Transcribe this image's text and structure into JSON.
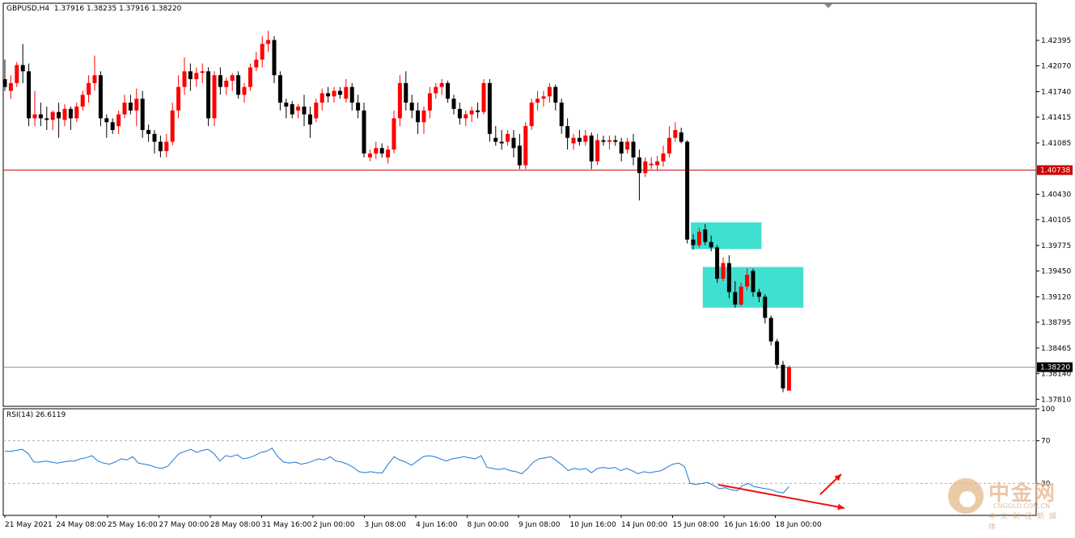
{
  "header": {
    "symbol": "GBPUSD,H4",
    "open": "1.37916",
    "high": "1.38235",
    "low": "1.37916",
    "close": "1.38220"
  },
  "rsi_label": "RSI(14) 26.6119",
  "watermark": {
    "cn": "中金网",
    "en": "CNGOLD.COM.CN",
    "sub": "中文财经新媒体"
  },
  "colors": {
    "bull": "#ff0000",
    "bear": "#000000",
    "hline": "#cc0000",
    "zone": "#40e0d0",
    "rsi": "#1e78d0",
    "arrow": "#ee1111"
  },
  "chart_data": [
    {
      "type": "candlestick",
      "title": "GBPUSD,H4",
      "ylim": [
        1.3772,
        1.4287
      ],
      "yticks": [
        "1.42395",
        "1.42070",
        "1.41740",
        "1.41415",
        "1.41085",
        "1.40430",
        "1.40105",
        "1.39775",
        "1.39450",
        "1.39120",
        "1.38795",
        "1.38465",
        "1.38140",
        "1.37810"
      ],
      "xticks": [
        "21 May 2021",
        "24 May 08:00",
        "25 May 16:00",
        "27 May 00:00",
        "28 May 08:00",
        "31 May 16:00",
        "2 Jun 00:00",
        "3 Jun 08:00",
        "4 Jun 16:00",
        "8 Jun 00:00",
        "9 Jun 08:00",
        "10 Jun 16:00",
        "14 Jun 00:00",
        "15 Jun 08:00",
        "16 Jun 16:00",
        "18 Jun 00:00"
      ],
      "hlines": [
        {
          "value": 1.40738,
          "label": "1.40738",
          "style": "red"
        },
        {
          "value": 1.3822,
          "label": "1.38220",
          "style": "current"
        }
      ],
      "zones": [
        {
          "from_index": 115,
          "to_index": 126,
          "low": 1.3973,
          "high": 1.4007
        },
        {
          "from_index": 117,
          "to_index": 133,
          "low": 1.3898,
          "high": 1.395
        }
      ],
      "candles": [
        {
          "o": 1.419,
          "h": 1.4215,
          "l": 1.4175,
          "c": 1.418
        },
        {
          "o": 1.4175,
          "h": 1.4195,
          "l": 1.4165,
          "c": 1.4185
        },
        {
          "o": 1.4185,
          "h": 1.4212,
          "l": 1.418,
          "c": 1.4208
        },
        {
          "o": 1.4208,
          "h": 1.4235,
          "l": 1.4185,
          "c": 1.42
        },
        {
          "o": 1.42,
          "h": 1.421,
          "l": 1.413,
          "c": 1.414
        },
        {
          "o": 1.414,
          "h": 1.4175,
          "l": 1.413,
          "c": 1.4145
        },
        {
          "o": 1.4145,
          "h": 1.416,
          "l": 1.413,
          "c": 1.414
        },
        {
          "o": 1.414,
          "h": 1.4155,
          "l": 1.4125,
          "c": 1.4138
        },
        {
          "o": 1.4138,
          "h": 1.415,
          "l": 1.4125,
          "c": 1.4148
        },
        {
          "o": 1.4148,
          "h": 1.416,
          "l": 1.4115,
          "c": 1.414
        },
        {
          "o": 1.4138,
          "h": 1.4158,
          "l": 1.413,
          "c": 1.4152
        },
        {
          "o": 1.4152,
          "h": 1.4155,
          "l": 1.4125,
          "c": 1.414
        },
        {
          "o": 1.414,
          "h": 1.416,
          "l": 1.4135,
          "c": 1.4155
        },
        {
          "o": 1.4155,
          "h": 1.4175,
          "l": 1.415,
          "c": 1.417
        },
        {
          "o": 1.417,
          "h": 1.4195,
          "l": 1.416,
          "c": 1.4185
        },
        {
          "o": 1.4185,
          "h": 1.422,
          "l": 1.4175,
          "c": 1.4195
        },
        {
          "o": 1.4195,
          "h": 1.42,
          "l": 1.413,
          "c": 1.414
        },
        {
          "o": 1.414,
          "h": 1.4145,
          "l": 1.4115,
          "c": 1.4135
        },
        {
          "o": 1.4135,
          "h": 1.414,
          "l": 1.412,
          "c": 1.4125
        },
        {
          "o": 1.413,
          "h": 1.415,
          "l": 1.412,
          "c": 1.4145
        },
        {
          "o": 1.4145,
          "h": 1.417,
          "l": 1.414,
          "c": 1.416
        },
        {
          "o": 1.416,
          "h": 1.417,
          "l": 1.4145,
          "c": 1.415
        },
        {
          "o": 1.415,
          "h": 1.4178,
          "l": 1.413,
          "c": 1.4165
        },
        {
          "o": 1.4165,
          "h": 1.4175,
          "l": 1.4115,
          "c": 1.4125
        },
        {
          "o": 1.4125,
          "h": 1.4132,
          "l": 1.411,
          "c": 1.412
        },
        {
          "o": 1.412,
          "h": 1.4125,
          "l": 1.4095,
          "c": 1.411
        },
        {
          "o": 1.411,
          "h": 1.4118,
          "l": 1.409,
          "c": 1.4098
        },
        {
          "o": 1.4098,
          "h": 1.412,
          "l": 1.409,
          "c": 1.411
        },
        {
          "o": 1.411,
          "h": 1.416,
          "l": 1.4105,
          "c": 1.415
        },
        {
          "o": 1.415,
          "h": 1.4195,
          "l": 1.414,
          "c": 1.418
        },
        {
          "o": 1.418,
          "h": 1.4218,
          "l": 1.417,
          "c": 1.42
        },
        {
          "o": 1.42,
          "h": 1.421,
          "l": 1.4175,
          "c": 1.419
        },
        {
          "o": 1.419,
          "h": 1.4205,
          "l": 1.418,
          "c": 1.4198
        },
        {
          "o": 1.4198,
          "h": 1.421,
          "l": 1.4185,
          "c": 1.42
        },
        {
          "o": 1.42,
          "h": 1.4205,
          "l": 1.413,
          "c": 1.414
        },
        {
          "o": 1.414,
          "h": 1.42,
          "l": 1.413,
          "c": 1.4195
        },
        {
          "o": 1.4195,
          "h": 1.4205,
          "l": 1.417,
          "c": 1.418
        },
        {
          "o": 1.418,
          "h": 1.4192,
          "l": 1.417,
          "c": 1.4188
        },
        {
          "o": 1.4188,
          "h": 1.4198,
          "l": 1.4175,
          "c": 1.4195
        },
        {
          "o": 1.4195,
          "h": 1.42,
          "l": 1.4165,
          "c": 1.417
        },
        {
          "o": 1.417,
          "h": 1.4185,
          "l": 1.416,
          "c": 1.418
        },
        {
          "o": 1.418,
          "h": 1.421,
          "l": 1.4175,
          "c": 1.4205
        },
        {
          "o": 1.4205,
          "h": 1.4225,
          "l": 1.42,
          "c": 1.4215
        },
        {
          "o": 1.4215,
          "h": 1.4245,
          "l": 1.4205,
          "c": 1.4235
        },
        {
          "o": 1.4235,
          "h": 1.4252,
          "l": 1.4225,
          "c": 1.424
        },
        {
          "o": 1.424,
          "h": 1.4245,
          "l": 1.4185,
          "c": 1.4195
        },
        {
          "o": 1.4195,
          "h": 1.42,
          "l": 1.415,
          "c": 1.416
        },
        {
          "o": 1.416,
          "h": 1.4165,
          "l": 1.414,
          "c": 1.4155
        },
        {
          "o": 1.4158,
          "h": 1.4162,
          "l": 1.414,
          "c": 1.4145
        },
        {
          "o": 1.415,
          "h": 1.4158,
          "l": 1.414,
          "c": 1.4155
        },
        {
          "o": 1.4155,
          "h": 1.417,
          "l": 1.413,
          "c": 1.4145
        },
        {
          "o": 1.4145,
          "h": 1.4155,
          "l": 1.4115,
          "c": 1.4132
        },
        {
          "o": 1.414,
          "h": 1.4165,
          "l": 1.4135,
          "c": 1.416
        },
        {
          "o": 1.416,
          "h": 1.4178,
          "l": 1.415,
          "c": 1.4172
        },
        {
          "o": 1.4172,
          "h": 1.418,
          "l": 1.416,
          "c": 1.4168
        },
        {
          "o": 1.4168,
          "h": 1.418,
          "l": 1.416,
          "c": 1.4175
        },
        {
          "o": 1.4175,
          "h": 1.418,
          "l": 1.4165,
          "c": 1.417
        },
        {
          "o": 1.4165,
          "h": 1.419,
          "l": 1.416,
          "c": 1.418
        },
        {
          "o": 1.418,
          "h": 1.4185,
          "l": 1.415,
          "c": 1.416
        },
        {
          "o": 1.416,
          "h": 1.417,
          "l": 1.414,
          "c": 1.415
        },
        {
          "o": 1.415,
          "h": 1.416,
          "l": 1.409,
          "c": 1.4095
        },
        {
          "o": 1.409,
          "h": 1.41,
          "l": 1.4085,
          "c": 1.4095
        },
        {
          "o": 1.4095,
          "h": 1.411,
          "l": 1.4088,
          "c": 1.4102
        },
        {
          "o": 1.4102,
          "h": 1.4108,
          "l": 1.409,
          "c": 1.4095
        },
        {
          "o": 1.409,
          "h": 1.4105,
          "l": 1.4082,
          "c": 1.41
        },
        {
          "o": 1.41,
          "h": 1.415,
          "l": 1.4095,
          "c": 1.414
        },
        {
          "o": 1.414,
          "h": 1.4195,
          "l": 1.413,
          "c": 1.4185
        },
        {
          "o": 1.4185,
          "h": 1.42,
          "l": 1.415,
          "c": 1.416
        },
        {
          "o": 1.416,
          "h": 1.417,
          "l": 1.414,
          "c": 1.415
        },
        {
          "o": 1.415,
          "h": 1.416,
          "l": 1.412,
          "c": 1.4135
        },
        {
          "o": 1.4135,
          "h": 1.4155,
          "l": 1.412,
          "c": 1.415
        },
        {
          "o": 1.415,
          "h": 1.418,
          "l": 1.414,
          "c": 1.4172
        },
        {
          "o": 1.4172,
          "h": 1.4185,
          "l": 1.4165,
          "c": 1.418
        },
        {
          "o": 1.418,
          "h": 1.419,
          "l": 1.417,
          "c": 1.4185
        },
        {
          "o": 1.4185,
          "h": 1.4188,
          "l": 1.416,
          "c": 1.4165
        },
        {
          "o": 1.4165,
          "h": 1.417,
          "l": 1.4145,
          "c": 1.4152
        },
        {
          "o": 1.4152,
          "h": 1.416,
          "l": 1.4132,
          "c": 1.414
        },
        {
          "o": 1.414,
          "h": 1.415,
          "l": 1.413,
          "c": 1.4145
        },
        {
          "o": 1.4145,
          "h": 1.4155,
          "l": 1.4135,
          "c": 1.415
        },
        {
          "o": 1.415,
          "h": 1.416,
          "l": 1.414,
          "c": 1.4148
        },
        {
          "o": 1.4148,
          "h": 1.419,
          "l": 1.4145,
          "c": 1.4185
        },
        {
          "o": 1.4185,
          "h": 1.419,
          "l": 1.411,
          "c": 1.412
        },
        {
          "o": 1.4115,
          "h": 1.413,
          "l": 1.4105,
          "c": 1.411
        },
        {
          "o": 1.411,
          "h": 1.4125,
          "l": 1.41,
          "c": 1.4108
        },
        {
          "o": 1.411,
          "h": 1.4125,
          "l": 1.4105,
          "c": 1.412
        },
        {
          "o": 1.4115,
          "h": 1.4125,
          "l": 1.409,
          "c": 1.4102
        },
        {
          "o": 1.4105,
          "h": 1.412,
          "l": 1.4075,
          "c": 1.408
        },
        {
          "o": 1.408,
          "h": 1.4135,
          "l": 1.4075,
          "c": 1.413
        },
        {
          "o": 1.413,
          "h": 1.4165,
          "l": 1.4125,
          "c": 1.416
        },
        {
          "o": 1.416,
          "h": 1.4175,
          "l": 1.415,
          "c": 1.4165
        },
        {
          "o": 1.4165,
          "h": 1.4175,
          "l": 1.4155,
          "c": 1.4168
        },
        {
          "o": 1.4168,
          "h": 1.4185,
          "l": 1.416,
          "c": 1.418
        },
        {
          "o": 1.418,
          "h": 1.4183,
          "l": 1.415,
          "c": 1.416
        },
        {
          "o": 1.416,
          "h": 1.4165,
          "l": 1.412,
          "c": 1.413
        },
        {
          "o": 1.413,
          "h": 1.414,
          "l": 1.41,
          "c": 1.4115
        },
        {
          "o": 1.4108,
          "h": 1.412,
          "l": 1.41,
          "c": 1.4115
        },
        {
          "o": 1.4115,
          "h": 1.4125,
          "l": 1.4105,
          "c": 1.411
        },
        {
          "o": 1.411,
          "h": 1.4125,
          "l": 1.4105,
          "c": 1.4118
        },
        {
          "o": 1.4118,
          "h": 1.4122,
          "l": 1.4075,
          "c": 1.4085
        },
        {
          "o": 1.4085,
          "h": 1.412,
          "l": 1.408,
          "c": 1.4112
        },
        {
          "o": 1.4112,
          "h": 1.4118,
          "l": 1.4105,
          "c": 1.411
        },
        {
          "o": 1.411,
          "h": 1.4118,
          "l": 1.41,
          "c": 1.4112
        },
        {
          "o": 1.4112,
          "h": 1.4118,
          "l": 1.4105,
          "c": 1.411
        },
        {
          "o": 1.411,
          "h": 1.4115,
          "l": 1.4085,
          "c": 1.4095
        },
        {
          "o": 1.41,
          "h": 1.4115,
          "l": 1.4095,
          "c": 1.411
        },
        {
          "o": 1.411,
          "h": 1.412,
          "l": 1.408,
          "c": 1.409
        },
        {
          "o": 1.409,
          "h": 1.41,
          "l": 1.4035,
          "c": 1.407
        },
        {
          "o": 1.407,
          "h": 1.409,
          "l": 1.4065,
          "c": 1.4085
        },
        {
          "o": 1.408,
          "h": 1.409,
          "l": 1.4075,
          "c": 1.4082
        },
        {
          "o": 1.408,
          "h": 1.4092,
          "l": 1.4074,
          "c": 1.4085
        },
        {
          "o": 1.4085,
          "h": 1.4105,
          "l": 1.4078,
          "c": 1.4095
        },
        {
          "o": 1.4095,
          "h": 1.413,
          "l": 1.409,
          "c": 1.4115
        },
        {
          "o": 1.4115,
          "h": 1.4135,
          "l": 1.411,
          "c": 1.4125
        },
        {
          "o": 1.4122,
          "h": 1.4128,
          "l": 1.4108,
          "c": 1.411
        },
        {
          "o": 1.411,
          "h": 1.4112,
          "l": 1.398,
          "c": 1.3985
        },
        {
          "o": 1.3985,
          "h": 1.3992,
          "l": 1.3972,
          "c": 1.3978
        },
        {
          "o": 1.3978,
          "h": 1.4,
          "l": 1.3975,
          "c": 1.3995
        },
        {
          "o": 1.3998,
          "h": 1.4005,
          "l": 1.3978,
          "c": 1.3982
        },
        {
          "o": 1.3982,
          "h": 1.399,
          "l": 1.397,
          "c": 1.3975
        },
        {
          "o": 1.3975,
          "h": 1.3978,
          "l": 1.393,
          "c": 1.3935
        },
        {
          "o": 1.3935,
          "h": 1.3962,
          "l": 1.3932,
          "c": 1.3955
        },
        {
          "o": 1.3955,
          "h": 1.3965,
          "l": 1.391,
          "c": 1.3918
        },
        {
          "o": 1.3918,
          "h": 1.3932,
          "l": 1.3898,
          "c": 1.3902
        },
        {
          "o": 1.3902,
          "h": 1.393,
          "l": 1.39,
          "c": 1.3925
        },
        {
          "o": 1.3925,
          "h": 1.3948,
          "l": 1.392,
          "c": 1.394
        },
        {
          "o": 1.3945,
          "h": 1.3948,
          "l": 1.3912,
          "c": 1.3918
        },
        {
          "o": 1.3918,
          "h": 1.3922,
          "l": 1.3905,
          "c": 1.3912
        },
        {
          "o": 1.3912,
          "h": 1.3915,
          "l": 1.3878,
          "c": 1.3885
        },
        {
          "o": 1.3885,
          "h": 1.3888,
          "l": 1.385,
          "c": 1.3855
        },
        {
          "o": 1.3855,
          "h": 1.3858,
          "l": 1.382,
          "c": 1.3825
        },
        {
          "o": 1.3825,
          "h": 1.383,
          "l": 1.379,
          "c": 1.3795
        },
        {
          "o": 1.3792,
          "h": 1.3824,
          "l": 1.3792,
          "c": 1.3822
        }
      ]
    },
    {
      "type": "line",
      "title": "RSI(14) 26.6119",
      "ylim": [
        0,
        100
      ],
      "yticks": [
        "100",
        "70",
        "30"
      ],
      "levels": [
        70,
        30
      ],
      "series": [
        {
          "values": [
            60,
            60,
            61,
            62,
            58,
            50,
            50,
            51,
            50,
            49,
            50,
            51,
            51,
            53,
            54,
            56,
            51,
            49,
            48,
            50,
            53,
            52,
            55,
            49,
            48,
            47,
            45,
            44,
            46,
            52,
            58,
            60,
            62,
            59,
            61,
            62,
            58,
            51,
            56,
            55,
            57,
            53,
            54,
            56,
            59,
            60,
            63,
            55,
            50,
            49,
            50,
            48,
            49,
            51,
            53,
            52,
            55,
            51,
            50,
            48,
            45,
            41,
            40,
            41,
            40,
            40,
            48,
            55,
            52,
            50,
            47,
            51,
            55,
            56,
            55,
            53,
            51,
            53,
            54,
            55,
            54,
            53,
            56,
            45,
            44,
            43,
            44,
            42,
            41,
            39,
            44,
            50,
            53,
            54,
            55,
            51,
            47,
            42,
            44,
            43,
            44,
            40,
            44,
            45,
            44,
            45,
            42,
            44,
            42,
            39,
            41,
            40,
            41,
            42,
            45,
            48,
            49,
            46,
            30,
            29,
            30,
            31,
            28,
            25,
            26,
            24,
            23,
            28,
            30,
            27,
            26,
            25,
            24,
            22,
            21,
            27
          ]
        }
      ]
    }
  ]
}
